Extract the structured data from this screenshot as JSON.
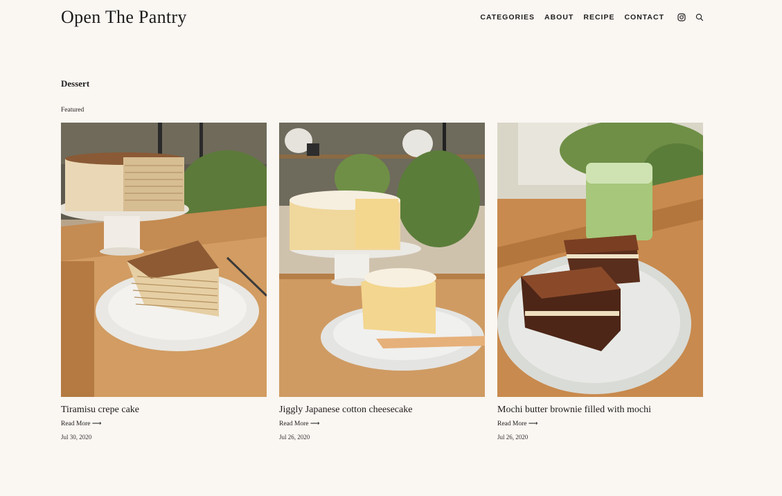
{
  "site": {
    "title": "Open The Pantry"
  },
  "nav": {
    "items": [
      {
        "label": "CATEGORIES"
      },
      {
        "label": "ABOUT"
      },
      {
        "label": "RECIPE"
      },
      {
        "label": "CONTACT"
      }
    ],
    "icons": [
      "instagram-icon",
      "search-icon"
    ]
  },
  "page": {
    "heading": "Dessert",
    "section_label": "Featured"
  },
  "posts": [
    {
      "title": "Tiramisu crepe cake",
      "read_more": "Read More ⟶",
      "date": "Jul 30, 2020"
    },
    {
      "title": "Jiggly Japanese cotton cheesecake",
      "read_more": "Read More ⟶",
      "date": "Jul 26, 2020"
    },
    {
      "title": "Mochi butter brownie filled with mochi",
      "read_more": "Read More ⟶",
      "date": "Jul 26, 2020"
    }
  ],
  "colors": {
    "background": "#faf6f2",
    "text": "#1e1e1e",
    "wood": "#c9925a"
  }
}
